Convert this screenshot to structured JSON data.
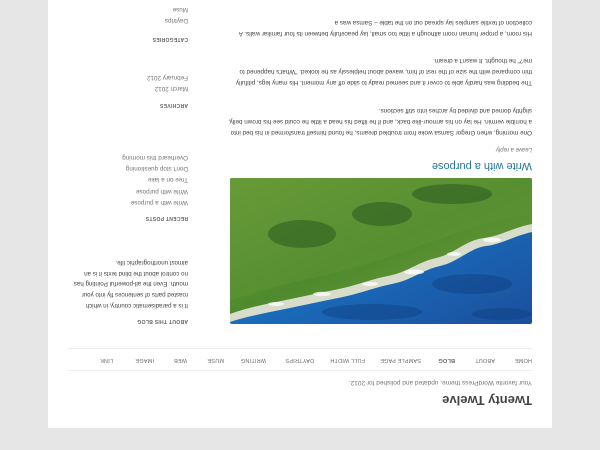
{
  "site": {
    "title": "Twenty Twelve",
    "description": "Your favorite WordPress theme, updated and polished for 2012."
  },
  "nav": {
    "items": [
      {
        "label": "HOME"
      },
      {
        "label": "ABOUT"
      },
      {
        "label": "BLOG",
        "current": true
      },
      {
        "label": "SAMPLE PAGE"
      },
      {
        "label": "FULL WIDTH"
      },
      {
        "label": "DAYTRIPS"
      },
      {
        "label": "WRITING"
      },
      {
        "label": "MUSE"
      },
      {
        "label": "WEB"
      },
      {
        "label": "IMAGE"
      },
      {
        "label": "LINK"
      }
    ]
  },
  "post": {
    "title": "Write with a purpose",
    "meta": "Leave a reply",
    "paragraphs": [
      "One morning, when Gregor Samsa woke from troubled dreams, he found himself transformed in his bed into a horrible vermin. He lay on his armour-like back, and if he lifted his head a little he could see his brown belly, slightly domed and divided by arches into stiff sections.",
      "The bedding was hardly able to cover it and seemed ready to slide off any moment. His many legs, pitifully thin compared with the size of the rest of him, waved about helplessly as he looked. \"What's happened to me?\" he thought. It wasn't a dream.",
      "His room, a proper human room although a little too small, lay peacefully between its four familiar walls. A collection of textile samples lay spread out on the table – Samsa was a"
    ]
  },
  "sidebar": {
    "about_title": "ABOUT THIS BLOG",
    "about_text": "It is a paradisematic country, in which roasted parts of sentences fly into your mouth. Even the all-powerful Pointing has no control about the blind texts it is an almost unorthographic life.",
    "recent_title": "RECENT POSTS",
    "recent_posts": [
      "Write with a purpose",
      "Write with purpose",
      "Tree on a lake",
      "Don't stop questioning",
      "Overheard this morning"
    ],
    "archives_title": "ARCHIVES",
    "archives": [
      "March 2012",
      "February 2012"
    ],
    "categories_title": "CATEGORIES",
    "categories": [
      "Daytrips",
      "Muse"
    ]
  }
}
